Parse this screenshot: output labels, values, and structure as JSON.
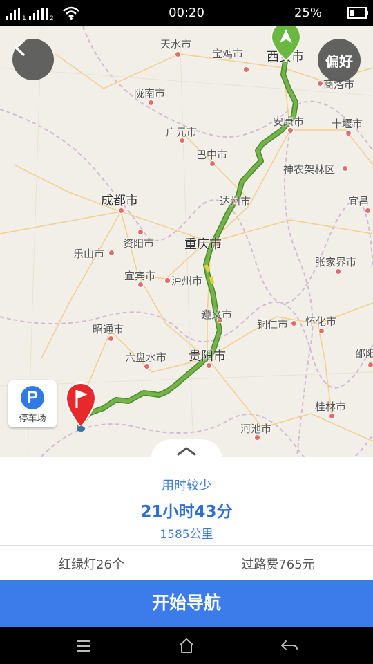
{
  "status_bar": {
    "time": "00:20",
    "battery": "25%"
  },
  "map": {
    "preference_label": "偏好",
    "parking_label": "停车场",
    "parking_icon_letter": "P",
    "cities": [
      "天水市",
      "宝鸡市",
      "西安市",
      "商洛市",
      "陇南市",
      "广元市",
      "安康市",
      "十堰市",
      "巴中市",
      "神农架林区",
      "成都市",
      "达州市",
      "宜昌",
      "资阳市",
      "重庆市",
      "乐山市",
      "张家界市",
      "宜宾市",
      "泸州市",
      "遵义市",
      "铜仁市",
      "怀化市",
      "昭通市",
      "六盘水市",
      "贵阳市",
      "邵阳",
      "桂林市",
      "河池市"
    ]
  },
  "route": {
    "tag": "用时较少",
    "duration": "21小时43分",
    "distance": "1585公里",
    "traffic_lights": "红绿灯26个",
    "toll": "过路费765元"
  },
  "start_button": "开始导航",
  "colors": {
    "route": "#6aa843",
    "accent": "#3c7cea",
    "city_dot": "#e86a6a"
  },
  "icons": [
    "signal-icon",
    "wifi-icon",
    "battery-icon",
    "back-icon",
    "start-marker-icon",
    "destination-flag-icon",
    "chevron-up-icon",
    "menu-icon",
    "home-icon",
    "back-nav-icon"
  ]
}
